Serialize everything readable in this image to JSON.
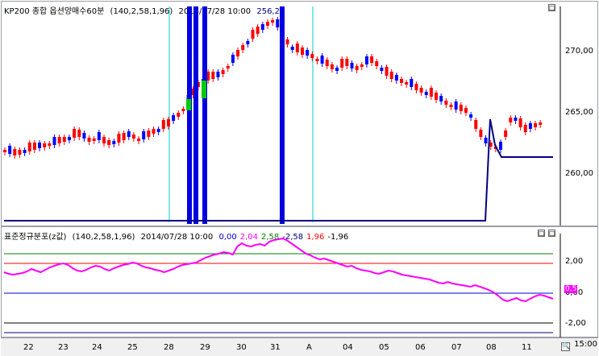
{
  "top": {
    "title": "KP200 종합 옵션양매수60분",
    "params": "(140,2,58,1,96)",
    "date": "2014/07/28 10:00",
    "value": "256,23",
    "y_ticks": [
      "270,00",
      "265,00",
      "260,00"
    ],
    "buttons": [
      "□",
      "□"
    ]
  },
  "bottom": {
    "title": "표준정규분포(z값)",
    "params": "(140,2,58,1,96)",
    "date": "2014/07/28 10:00",
    "values": [
      {
        "text": "0,00",
        "color": "#0000cc"
      },
      {
        "text": "2,04",
        "color": "#ff00ff"
      },
      {
        "text": "2,58",
        "color": "#008000"
      },
      {
        "text": "-2,58",
        "color": "#000080"
      },
      {
        "text": "1,96",
        "color": "#ff0000"
      },
      {
        "text": "-1,96",
        "color": "#000000"
      }
    ],
    "y_ticks": [
      "2,00",
      "0,00",
      "-2,00"
    ],
    "last_badge": "0,5",
    "buttons": [
      "□",
      "□"
    ]
  },
  "x_axis": {
    "labels": [
      "22",
      "23",
      "24",
      "25",
      "28",
      "29",
      "30",
      "31",
      "A",
      "04",
      "05",
      "06",
      "07",
      "08",
      "11"
    ],
    "right_time": "15:00"
  },
  "colors": {
    "up": "#ff0000",
    "down": "#0000ff",
    "highlight": "#00cc00",
    "zline": "#ff00ff",
    "navy": "#000080",
    "cyan": "#00cccc"
  }
}
